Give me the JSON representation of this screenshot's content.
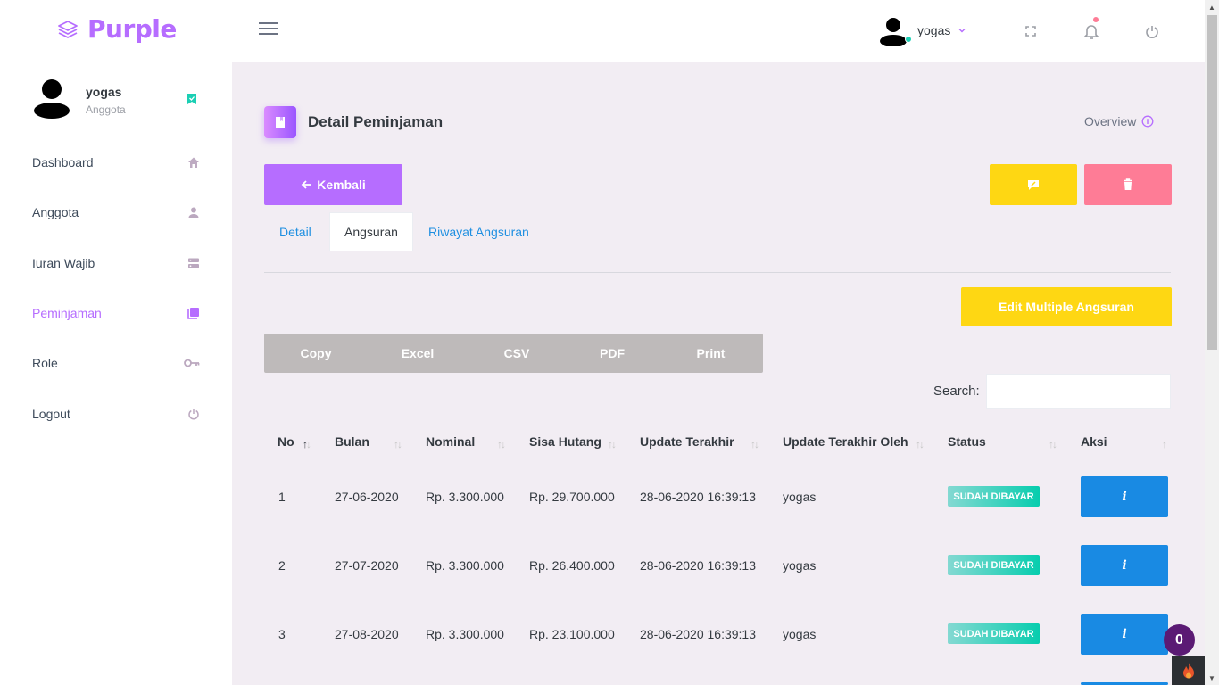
{
  "brand": {
    "name": "Purple"
  },
  "navbar": {
    "username": "yogas"
  },
  "sidebar": {
    "profile": {
      "name": "yogas",
      "role": "Anggota"
    },
    "items": [
      {
        "label": "Dashboard",
        "icon": "home-icon"
      },
      {
        "label": "Anggota",
        "icon": "user-icon"
      },
      {
        "label": "Iuran Wajib",
        "icon": "server-icon"
      },
      {
        "label": "Peminjaman",
        "icon": "book-icon",
        "active": true
      },
      {
        "label": "Role",
        "icon": "key-icon"
      },
      {
        "label": "Logout",
        "icon": "power-icon"
      }
    ]
  },
  "page": {
    "title": "Detail Peminjaman",
    "overview": "Overview",
    "back_label": "Kembali"
  },
  "tabs": [
    "Detail",
    "Angsuran",
    "Riwayat Angsuran"
  ],
  "multi_edit_label": "Edit Multiple Angsuran",
  "export_buttons": [
    "Copy",
    "Excel",
    "CSV",
    "PDF",
    "Print"
  ],
  "search": {
    "label": "Search:",
    "value": ""
  },
  "table": {
    "columns": [
      "No",
      "Bulan",
      "Nominal",
      "Sisa Hutang",
      "Update Terakhir",
      "Update Terakhir Oleh",
      "Status",
      "Aksi"
    ],
    "rows": [
      {
        "no": "1",
        "bulan": "27-06-2020",
        "nominal": "Rp. 3.300.000",
        "sisa": "Rp. 29.700.000",
        "update": "28-06-2020 16:39:13",
        "oleh": "yogas",
        "status": "SUDAH DIBAYAR",
        "aksi": "i"
      },
      {
        "no": "2",
        "bulan": "27-07-2020",
        "nominal": "Rp. 3.300.000",
        "sisa": "Rp. 26.400.000",
        "update": "28-06-2020 16:39:13",
        "oleh": "yogas",
        "status": "SUDAH DIBAYAR",
        "aksi": "i"
      },
      {
        "no": "3",
        "bulan": "27-08-2020",
        "nominal": "Rp. 3.300.000",
        "sisa": "Rp. 23.100.000",
        "update": "28-06-2020 16:39:13",
        "oleh": "yogas",
        "status": "SUDAH DIBAYAR",
        "aksi": "i"
      }
    ]
  },
  "widget": {
    "count": "0"
  },
  "colors": {
    "primary": "#b66dff",
    "warning": "#fed713",
    "danger": "#fe7c96",
    "info": "#198ae3",
    "success": "#1bcfb4",
    "background": "#f2edf3"
  }
}
